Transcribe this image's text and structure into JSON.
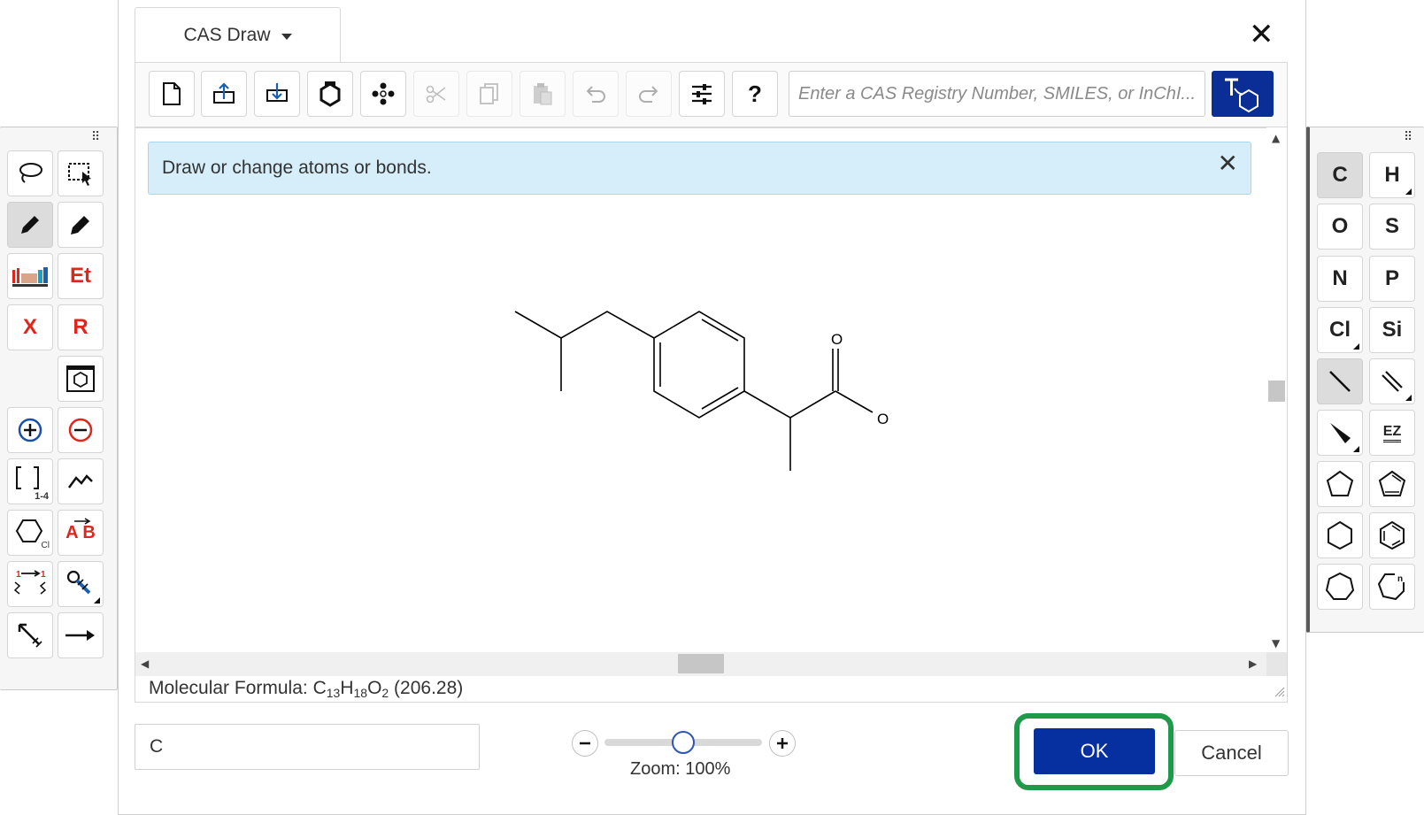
{
  "dialog": {
    "title": "CAS Draw",
    "info_message": "Draw or change atoms or bonds.",
    "search_placeholder": "Enter a CAS Registry Number, SMILES, or InChI...",
    "formula_prefix": "Molecular Formula: ",
    "formula": {
      "c": "C",
      "c_n": "13",
      "h": "H",
      "h_n": "18",
      "o": "O",
      "o_n": "2",
      "mass": " (206.28)"
    },
    "atom_input_value": "C",
    "zoom_label": "Zoom: 100%",
    "zoom_level_percent": 100,
    "ok_label": "OK",
    "cancel_label": "Cancel"
  },
  "left_palette": {
    "text_tools": {
      "ethyl": "Et",
      "halogen": "X",
      "rgroup": "R",
      "ab": "A B",
      "bracket_range": "1-4",
      "cl_sub": "Cl"
    }
  },
  "right_palette": {
    "atoms": [
      "C",
      "H",
      "O",
      "S",
      "N",
      "P",
      "Cl",
      "Si"
    ],
    "ez_label": "EZ"
  },
  "molecule": {
    "atom_labels": {
      "o1": "O",
      "o2": "O"
    },
    "bond_color": "#000000"
  },
  "colors": {
    "primary": "#062f9f",
    "highlight_ring": "#1f9a48",
    "info_bg": "#d6eefa",
    "red_tool": "#e0261c"
  }
}
